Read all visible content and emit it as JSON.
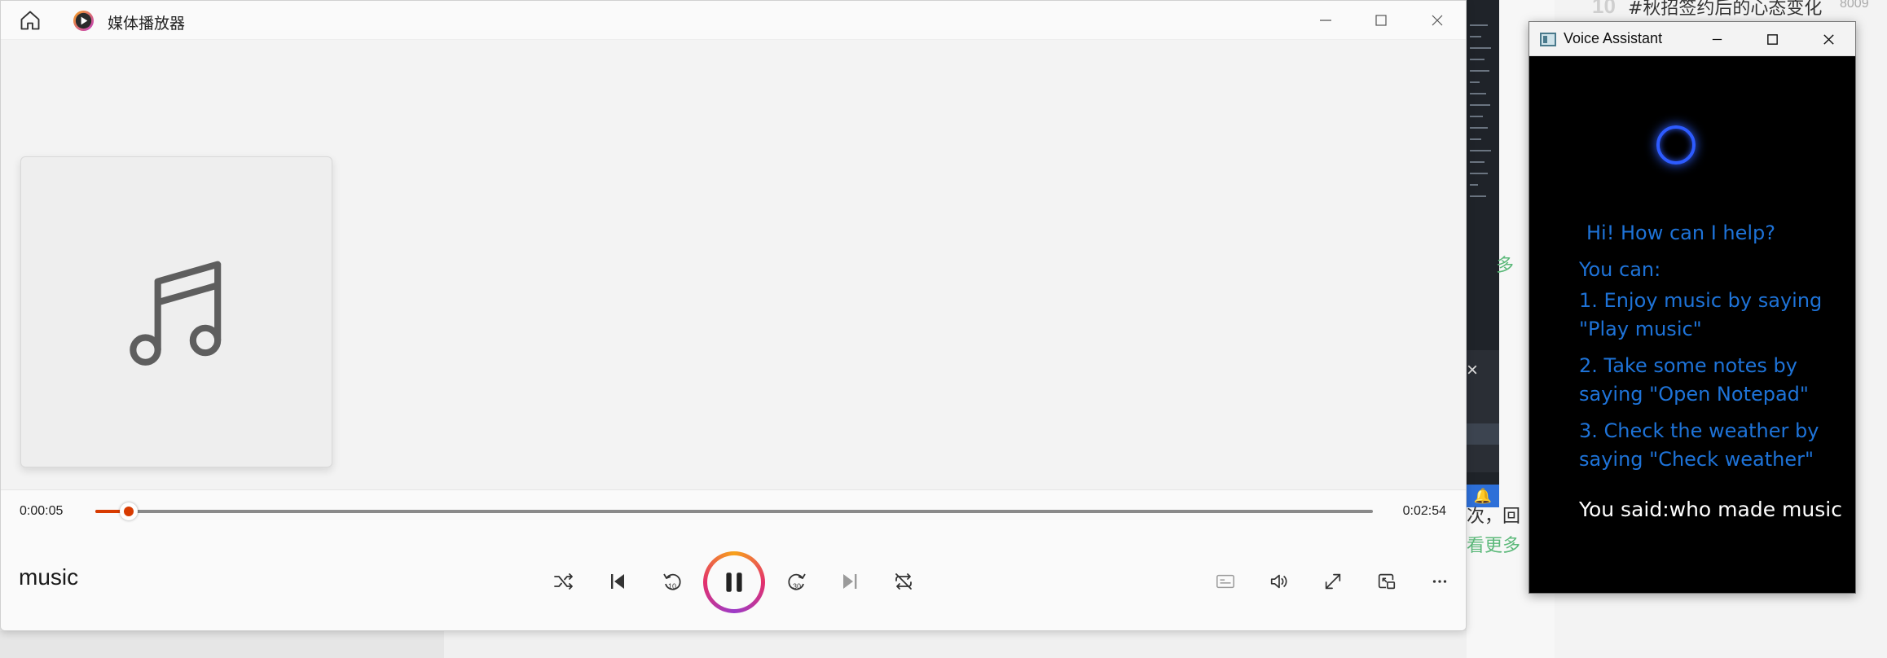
{
  "background": {
    "top_rank": "10",
    "top_text": "#秋招签约后的心态变化",
    "top_count": "8009",
    "green_1": "多",
    "text_2": "次，回",
    "green_3": "看更多"
  },
  "player": {
    "title": "媒体播放器",
    "current_time": "0:00:05",
    "total_time": "0:02:54",
    "progress_fraction": 0.026,
    "track_title": "music",
    "accent_color": "#d83b01",
    "icons": {
      "home": "home-icon",
      "logo": "media-player-logo-icon",
      "shuffle": "shuffle-icon",
      "previous": "previous-icon",
      "rewind": "rewind-10-icon",
      "pause": "pause-icon",
      "forward": "forward-30-icon",
      "next": "next-icon",
      "repeat": "repeat-icon",
      "captions": "captions-icon",
      "volume": "volume-icon",
      "fullscreen": "fullscreen-icon",
      "mini": "mini-player-icon",
      "more": "more-icon",
      "album_art": "music-note-icon"
    },
    "rewind_label": "10",
    "forward_label": "30"
  },
  "assistant": {
    "title": "Voice Assistant",
    "greeting": "Hi! How can I help?",
    "you_can": "You can:",
    "tips": [
      [
        "1. Enjoy music by saying",
        "\"Play music\""
      ],
      [
        "2. Take some notes by",
        "saying \"Open Notepad\""
      ],
      [
        "3. Check the weather by",
        "saying \"Check weather\""
      ]
    ],
    "you_said": "You said:who made music",
    "text_color": "#1e73d8"
  }
}
